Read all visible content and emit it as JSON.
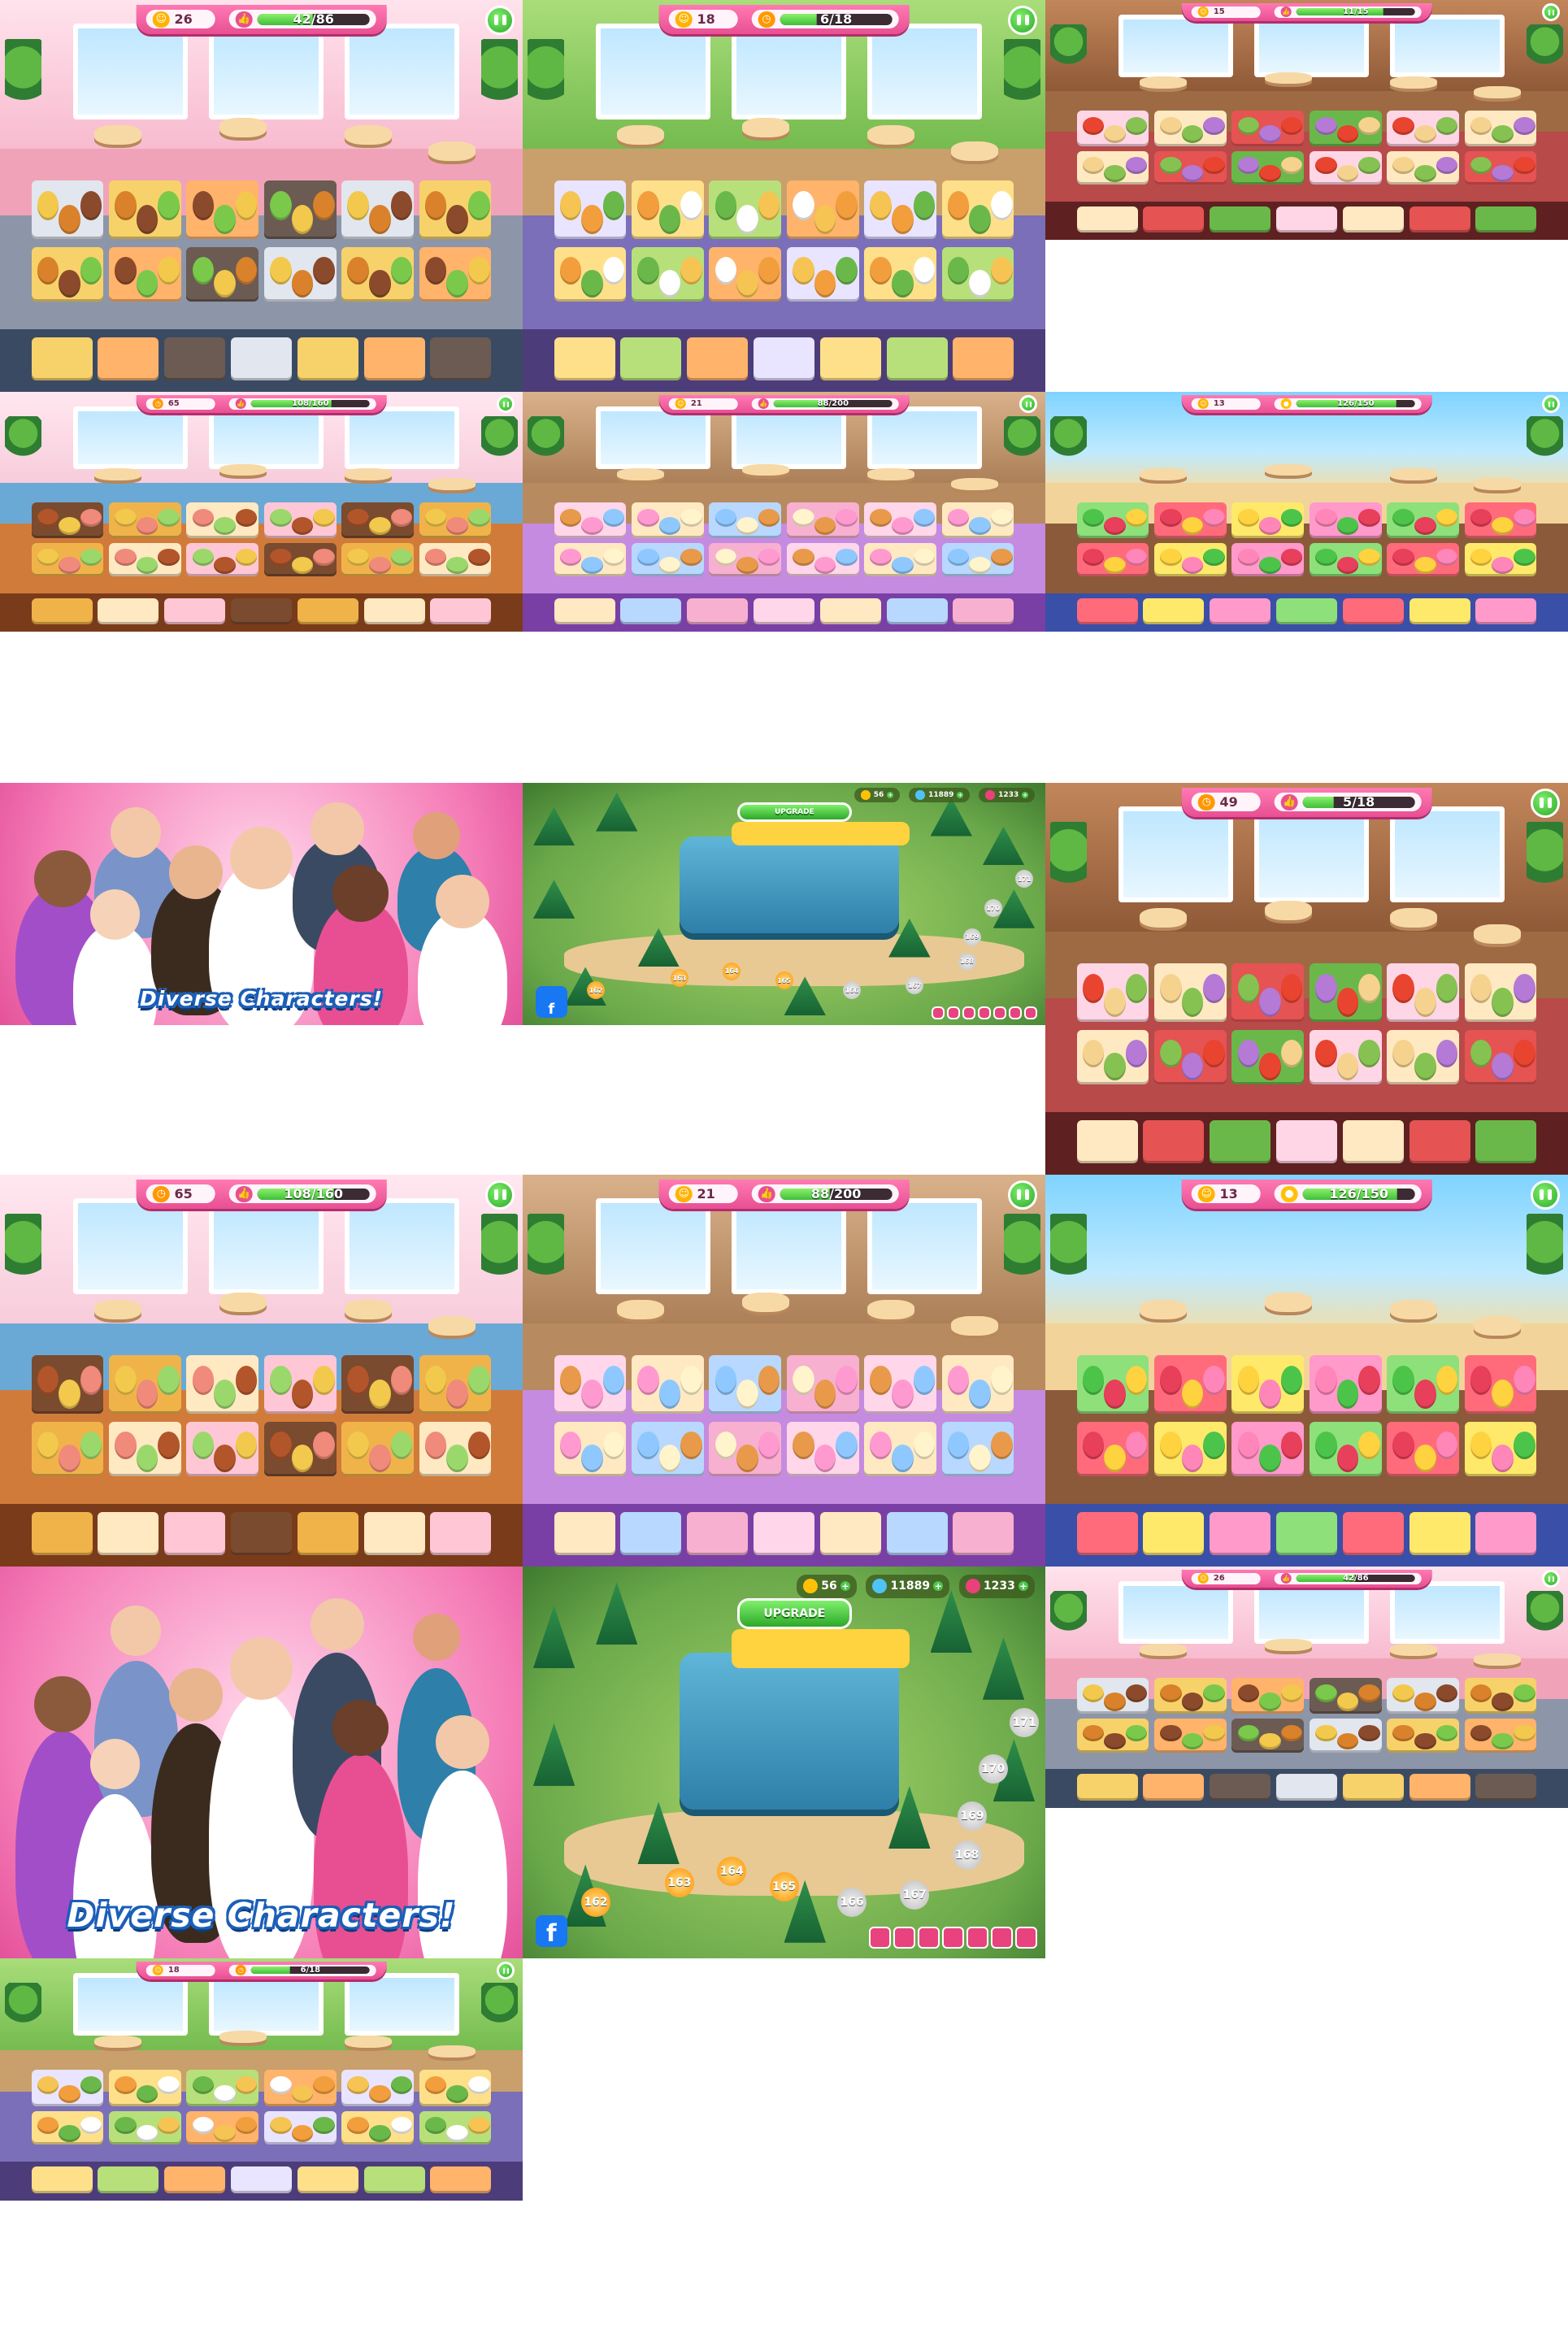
{
  "gallery": {
    "tiles": [
      {
        "id": "t1",
        "theme": "diner",
        "hud": {
          "left_value": "26",
          "progress_text": "42/86",
          "progress": 0.49,
          "left_icon": "customer-icon",
          "mid_icon": "thumbs-up-icon"
        }
      },
      {
        "id": "t2",
        "theme": "camp",
        "hud": {
          "left_value": "18",
          "progress_text": "6/18",
          "progress": 0.33,
          "left_icon": "customer-icon",
          "mid_icon": "clock-icon"
        }
      },
      {
        "id": "t3",
        "theme": "italian",
        "hud": {
          "left_value": "15",
          "progress_text": "11/15",
          "progress": 0.73,
          "left_icon": "customer-icon",
          "mid_icon": "thumbs-up-icon"
        }
      },
      {
        "id": "t4",
        "theme": "grill",
        "hud": {
          "left_value": "65",
          "progress_text": "108/160",
          "progress": 0.68,
          "left_icon": "clock-icon",
          "mid_icon": "thumbs-up-icon"
        }
      },
      {
        "id": "t5",
        "theme": "bakery",
        "hud": {
          "left_value": "21",
          "progress_text": "88/200",
          "progress": 0.44,
          "left_icon": "customer-icon",
          "mid_icon": "thumbs-up-icon"
        }
      },
      {
        "id": "t6",
        "theme": "beach",
        "hud": {
          "left_value": "13",
          "progress_text": "126/150",
          "progress": 0.84,
          "left_icon": "customer-icon",
          "mid_icon": "coin-icon"
        }
      },
      {
        "id": "t7",
        "theme": "characters",
        "title": "Diverse Characters!"
      },
      {
        "id": "t8",
        "theme": "map",
        "map": {
          "coins": "56",
          "gems": "11889",
          "hearts": "1233",
          "upgrade": "UPGRADE",
          "levels": [
            "169",
            "170",
            "171",
            "168",
            "167",
            "166",
            "165",
            "164",
            "163",
            "162"
          ]
        }
      },
      {
        "id": "t9",
        "theme": "italian",
        "hud": {
          "left_value": "49",
          "progress_text": "5/18",
          "progress": 0.28,
          "left_icon": "clock-icon",
          "mid_icon": "thumbs-up-icon"
        }
      },
      {
        "id": "t10",
        "theme": "grill",
        "hud": {
          "left_value": "65",
          "progress_text": "108/160",
          "progress": 0.68,
          "left_icon": "clock-icon",
          "mid_icon": "thumbs-up-icon"
        }
      },
      {
        "id": "t11",
        "theme": "bakery",
        "hud": {
          "left_value": "21",
          "progress_text": "88/200",
          "progress": 0.44,
          "left_icon": "customer-icon",
          "mid_icon": "thumbs-up-icon"
        }
      },
      {
        "id": "t12",
        "theme": "beach",
        "hud": {
          "left_value": "13",
          "progress_text": "126/150",
          "progress": 0.84,
          "left_icon": "customer-icon",
          "mid_icon": "coin-icon"
        }
      },
      {
        "id": "t13",
        "theme": "characters",
        "title": "Diverse Characters!"
      },
      {
        "id": "t14",
        "theme": "map",
        "map": {
          "coins": "56",
          "gems": "11889",
          "hearts": "1233",
          "upgrade": "UPGRADE",
          "levels": [
            "169",
            "170",
            "171",
            "168",
            "167",
            "166",
            "165",
            "164",
            "163",
            "162"
          ]
        }
      },
      {
        "id": "t15",
        "theme": "diner",
        "hud": {
          "left_value": "26",
          "progress_text": "42/86",
          "progress": 0.49,
          "left_icon": "customer-icon",
          "mid_icon": "thumbs-up-icon"
        }
      },
      {
        "id": "t16",
        "theme": "camp",
        "hud": {
          "left_value": "18",
          "progress_text": "6/18",
          "progress": 0.33,
          "left_icon": "customer-icon",
          "mid_icon": "clock-icon"
        }
      }
    ]
  },
  "colors": {
    "hud_pink": "#e84f93",
    "pause_green": "#2ea82a",
    "progress_green": "#3fbf3a",
    "background": "#ffffff"
  }
}
